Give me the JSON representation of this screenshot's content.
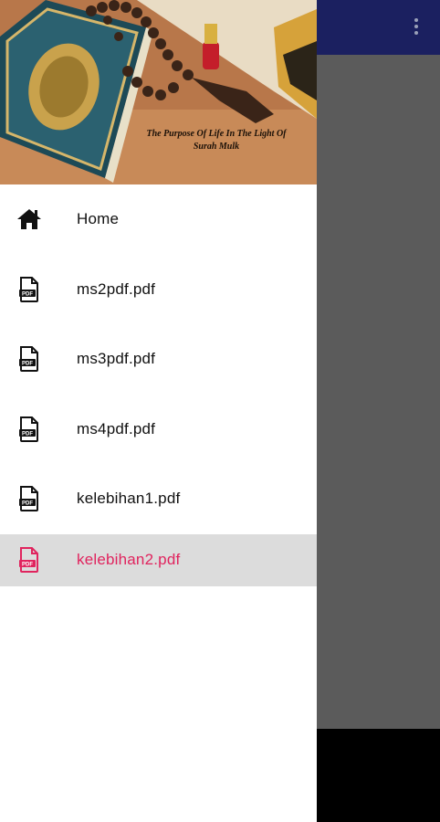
{
  "header": {
    "caption_line1": "The Purpose Of Life In The Light Of",
    "caption_line2": "Surah Mulk"
  },
  "colors": {
    "toolbar": "#1b2060",
    "scrim": "#5b5b5b",
    "accent": "#e0245e",
    "active_bg": "#dcdcdc"
  },
  "menu": {
    "items": [
      {
        "label": "Home",
        "icon": "home-icon"
      },
      {
        "label": "ms2pdf.pdf",
        "icon": "pdf-file-icon"
      },
      {
        "label": "ms3pdf.pdf",
        "icon": "pdf-file-icon"
      },
      {
        "label": "ms4pdf.pdf",
        "icon": "pdf-file-icon"
      },
      {
        "label": "kelebihan1.pdf",
        "icon": "pdf-file-icon"
      },
      {
        "label": "kelebihan2.pdf",
        "icon": "pdf-file-icon",
        "selected": true
      }
    ]
  }
}
